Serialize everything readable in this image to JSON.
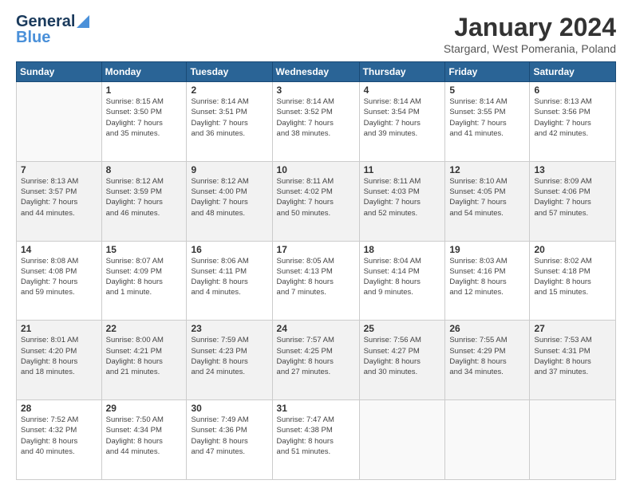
{
  "logo": {
    "line1": "General",
    "line2": "Blue"
  },
  "header": {
    "title": "January 2024",
    "subtitle": "Stargard, West Pomerania, Poland"
  },
  "days_of_week": [
    "Sunday",
    "Monday",
    "Tuesday",
    "Wednesday",
    "Thursday",
    "Friday",
    "Saturday"
  ],
  "weeks": [
    [
      {
        "num": "",
        "info": ""
      },
      {
        "num": "1",
        "info": "Sunrise: 8:15 AM\nSunset: 3:50 PM\nDaylight: 7 hours\nand 35 minutes."
      },
      {
        "num": "2",
        "info": "Sunrise: 8:14 AM\nSunset: 3:51 PM\nDaylight: 7 hours\nand 36 minutes."
      },
      {
        "num": "3",
        "info": "Sunrise: 8:14 AM\nSunset: 3:52 PM\nDaylight: 7 hours\nand 38 minutes."
      },
      {
        "num": "4",
        "info": "Sunrise: 8:14 AM\nSunset: 3:54 PM\nDaylight: 7 hours\nand 39 minutes."
      },
      {
        "num": "5",
        "info": "Sunrise: 8:14 AM\nSunset: 3:55 PM\nDaylight: 7 hours\nand 41 minutes."
      },
      {
        "num": "6",
        "info": "Sunrise: 8:13 AM\nSunset: 3:56 PM\nDaylight: 7 hours\nand 42 minutes."
      }
    ],
    [
      {
        "num": "7",
        "info": "Sunrise: 8:13 AM\nSunset: 3:57 PM\nDaylight: 7 hours\nand 44 minutes."
      },
      {
        "num": "8",
        "info": "Sunrise: 8:12 AM\nSunset: 3:59 PM\nDaylight: 7 hours\nand 46 minutes."
      },
      {
        "num": "9",
        "info": "Sunrise: 8:12 AM\nSunset: 4:00 PM\nDaylight: 7 hours\nand 48 minutes."
      },
      {
        "num": "10",
        "info": "Sunrise: 8:11 AM\nSunset: 4:02 PM\nDaylight: 7 hours\nand 50 minutes."
      },
      {
        "num": "11",
        "info": "Sunrise: 8:11 AM\nSunset: 4:03 PM\nDaylight: 7 hours\nand 52 minutes."
      },
      {
        "num": "12",
        "info": "Sunrise: 8:10 AM\nSunset: 4:05 PM\nDaylight: 7 hours\nand 54 minutes."
      },
      {
        "num": "13",
        "info": "Sunrise: 8:09 AM\nSunset: 4:06 PM\nDaylight: 7 hours\nand 57 minutes."
      }
    ],
    [
      {
        "num": "14",
        "info": "Sunrise: 8:08 AM\nSunset: 4:08 PM\nDaylight: 7 hours\nand 59 minutes."
      },
      {
        "num": "15",
        "info": "Sunrise: 8:07 AM\nSunset: 4:09 PM\nDaylight: 8 hours\nand 1 minute."
      },
      {
        "num": "16",
        "info": "Sunrise: 8:06 AM\nSunset: 4:11 PM\nDaylight: 8 hours\nand 4 minutes."
      },
      {
        "num": "17",
        "info": "Sunrise: 8:05 AM\nSunset: 4:13 PM\nDaylight: 8 hours\nand 7 minutes."
      },
      {
        "num": "18",
        "info": "Sunrise: 8:04 AM\nSunset: 4:14 PM\nDaylight: 8 hours\nand 9 minutes."
      },
      {
        "num": "19",
        "info": "Sunrise: 8:03 AM\nSunset: 4:16 PM\nDaylight: 8 hours\nand 12 minutes."
      },
      {
        "num": "20",
        "info": "Sunrise: 8:02 AM\nSunset: 4:18 PM\nDaylight: 8 hours\nand 15 minutes."
      }
    ],
    [
      {
        "num": "21",
        "info": "Sunrise: 8:01 AM\nSunset: 4:20 PM\nDaylight: 8 hours\nand 18 minutes."
      },
      {
        "num": "22",
        "info": "Sunrise: 8:00 AM\nSunset: 4:21 PM\nDaylight: 8 hours\nand 21 minutes."
      },
      {
        "num": "23",
        "info": "Sunrise: 7:59 AM\nSunset: 4:23 PM\nDaylight: 8 hours\nand 24 minutes."
      },
      {
        "num": "24",
        "info": "Sunrise: 7:57 AM\nSunset: 4:25 PM\nDaylight: 8 hours\nand 27 minutes."
      },
      {
        "num": "25",
        "info": "Sunrise: 7:56 AM\nSunset: 4:27 PM\nDaylight: 8 hours\nand 30 minutes."
      },
      {
        "num": "26",
        "info": "Sunrise: 7:55 AM\nSunset: 4:29 PM\nDaylight: 8 hours\nand 34 minutes."
      },
      {
        "num": "27",
        "info": "Sunrise: 7:53 AM\nSunset: 4:31 PM\nDaylight: 8 hours\nand 37 minutes."
      }
    ],
    [
      {
        "num": "28",
        "info": "Sunrise: 7:52 AM\nSunset: 4:32 PM\nDaylight: 8 hours\nand 40 minutes."
      },
      {
        "num": "29",
        "info": "Sunrise: 7:50 AM\nSunset: 4:34 PM\nDaylight: 8 hours\nand 44 minutes."
      },
      {
        "num": "30",
        "info": "Sunrise: 7:49 AM\nSunset: 4:36 PM\nDaylight: 8 hours\nand 47 minutes."
      },
      {
        "num": "31",
        "info": "Sunrise: 7:47 AM\nSunset: 4:38 PM\nDaylight: 8 hours\nand 51 minutes."
      },
      {
        "num": "",
        "info": ""
      },
      {
        "num": "",
        "info": ""
      },
      {
        "num": "",
        "info": ""
      }
    ]
  ]
}
